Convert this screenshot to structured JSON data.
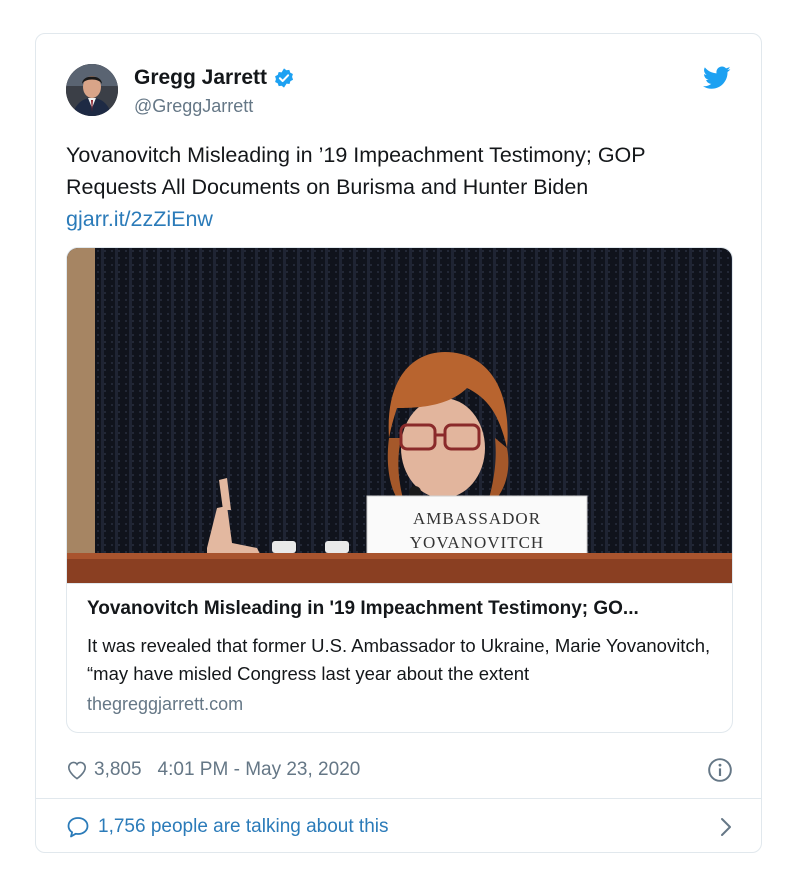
{
  "author": {
    "display_name": "Gregg Jarrett",
    "handle": "@GreggJarrett",
    "verified": true
  },
  "tweet": {
    "text": "Yovanovitch Misleading in ’19 Impeachment Testimony; GOP Requests All Documents on Burisma and Hunter Biden",
    "link": "gjarr.it/2zZiEnw"
  },
  "card": {
    "placard_line1": "AMBASSADOR",
    "placard_line2": "YOVANOVITCH",
    "title": "Yovanovitch Misleading in '19 Impeachment Testimony; GO...",
    "description": "It was revealed that former U.S. Ambassador to Ukraine, Marie Yovanovitch, “may have misled Congress last year about the extent",
    "domain": "thegreggjarrett.com"
  },
  "meta": {
    "likes": "3,805",
    "timestamp": "4:01 PM - May 23, 2020"
  },
  "footer": {
    "talking": "1,756 people are talking about this"
  },
  "icons": {
    "verified": "verified-badge-icon",
    "logo": "twitter-bird-icon",
    "like": "heart-icon",
    "info": "info-icon",
    "reply": "speech-bubble-icon",
    "chevron": "chevron-right-icon"
  },
  "colors": {
    "accent": "#1da1f2",
    "link": "#2b7bb9",
    "muted": "#657786",
    "text": "#14171a",
    "border": "#e1e8ed"
  }
}
